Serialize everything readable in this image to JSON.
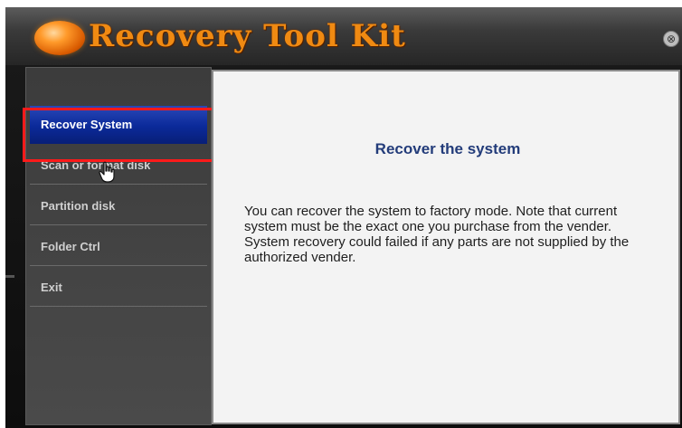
{
  "app": {
    "title": "Recovery Tool Kit",
    "close_glyph": "⊗"
  },
  "sidebar": {
    "items": [
      {
        "label": "Recover System",
        "active": true
      },
      {
        "label": "Scan or format disk",
        "active": false
      },
      {
        "label": "Partition disk",
        "active": false
      },
      {
        "label": "Folder Ctrl",
        "active": false
      },
      {
        "label": "Exit",
        "active": false
      }
    ]
  },
  "content": {
    "title": "Recover the system",
    "body": "You can recover the system to factory mode. Note that current system must be the exact one you purchase from the vender. System recovery could failed if any parts are not supplied by the authorized vender."
  },
  "colors": {
    "accent_orange": "#f08a12",
    "active_blue": "#0b2a9a",
    "highlight_red": "#ff1a1a",
    "title_blue": "#233c7a"
  },
  "icons": {
    "logo": "orange-orb-icon",
    "close": "close-icon",
    "cursor": "hand-pointer-icon"
  }
}
